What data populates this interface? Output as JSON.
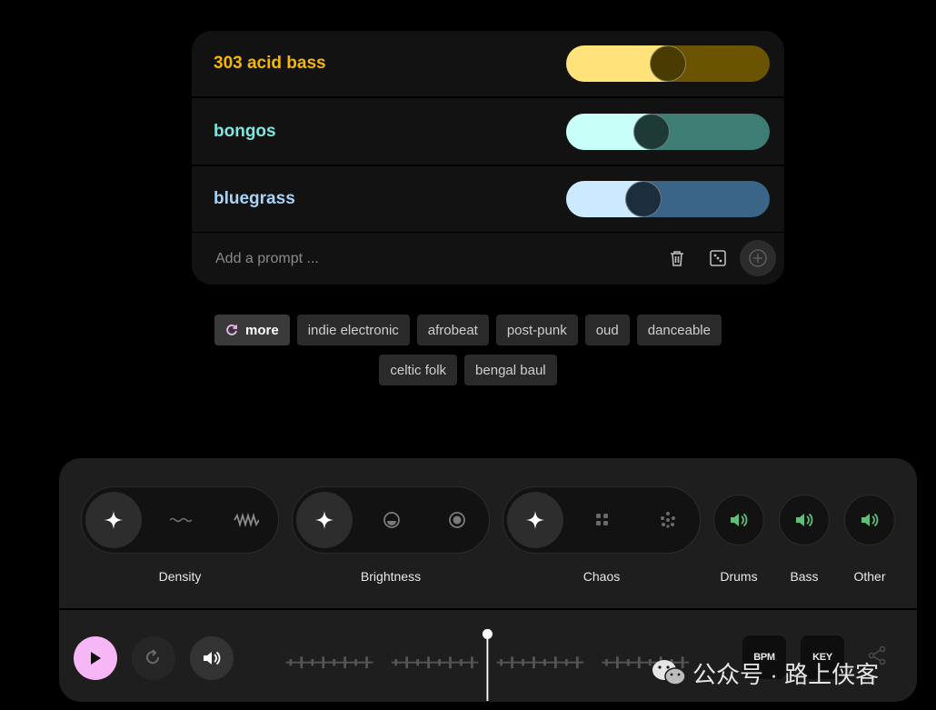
{
  "prompts": [
    {
      "label": "303 acid bass",
      "color": "#f5b800",
      "fill": "#ffe27a",
      "track": "#6b5400",
      "knob": "#4a3c00",
      "weight": 0.5
    },
    {
      "label": "bongos",
      "color": "#7fe7de",
      "fill": "#c8fff8",
      "track": "#3d7d73",
      "knob": "#1e3a36",
      "weight": 0.42
    },
    {
      "label": "bluegrass",
      "color": "#a8d3f5",
      "fill": "#cde9ff",
      "track": "#3a6488",
      "knob": "#1c2e3e",
      "weight": 0.38
    }
  ],
  "add_prompt": {
    "placeholder": "Add a prompt ..."
  },
  "icons": {
    "delete": "trash-icon",
    "random": "dice-icon",
    "add": "plus-circle-icon"
  },
  "chips": {
    "more_label": "more",
    "row1": [
      "indie electronic",
      "afrobeat",
      "post-punk",
      "oud",
      "danceable"
    ],
    "row2": [
      "celtic folk",
      "bengal baul"
    ]
  },
  "controls": {
    "density": {
      "label": "Density",
      "options": [
        "sparkle-icon",
        "wave-low-icon",
        "wave-high-icon"
      ],
      "selected": 0
    },
    "brightness": {
      "label": "Brightness",
      "options": [
        "sparkle-icon",
        "dim-circle-icon",
        "bright-circle-icon"
      ],
      "selected": 0
    },
    "chaos": {
      "label": "Chaos",
      "options": [
        "sparkle-icon",
        "dots-grid-icon",
        "dots-scatter-icon"
      ],
      "selected": 0
    },
    "stems": [
      {
        "label": "Drums",
        "icon": "speaker-icon"
      },
      {
        "label": "Bass",
        "icon": "speaker-icon"
      },
      {
        "label": "Other",
        "icon": "speaker-icon"
      }
    ]
  },
  "transport": {
    "bpm_label": "BPM",
    "key_label": "KEY",
    "play_color": "#f7b6f5",
    "accent_green": "#5fbf7a"
  },
  "watermark": {
    "text": "公众号 · 路上侠客"
  }
}
